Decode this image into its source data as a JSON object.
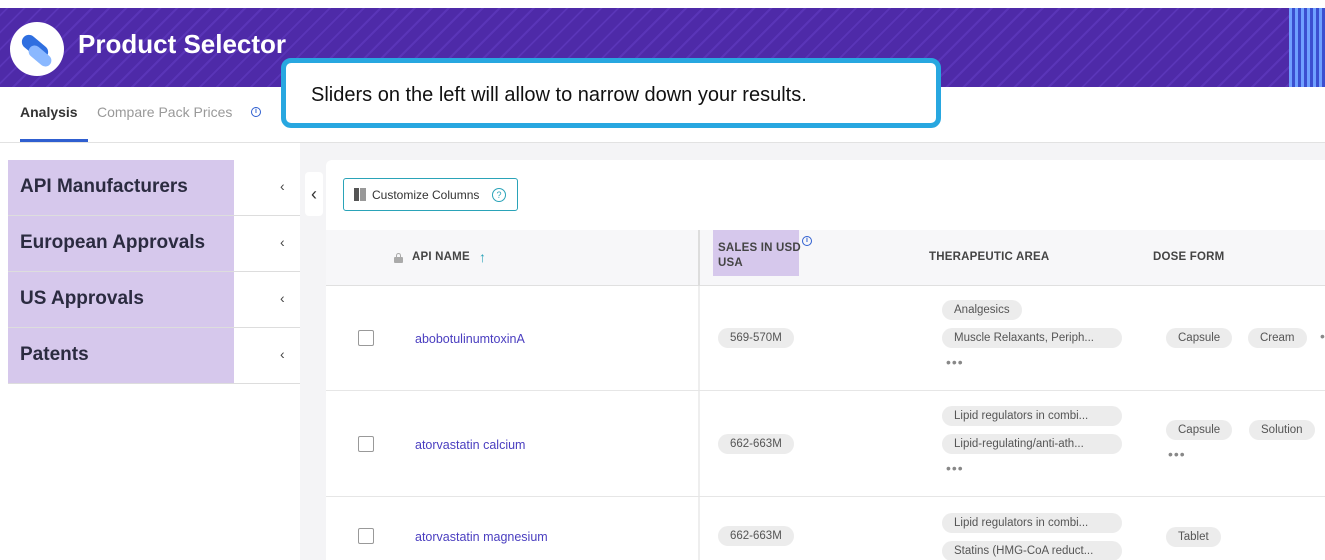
{
  "app": {
    "title": "Product Selector"
  },
  "tabs": [
    {
      "label": "Analysis",
      "active": true
    },
    {
      "label": "Compare Pack Prices",
      "active": false
    }
  ],
  "callout": {
    "text": "Sliders on the left will allow to narrow down your results."
  },
  "sidebar": {
    "items": [
      {
        "label": "API Manufacturers",
        "chevron": "‹"
      },
      {
        "label": "European Approvals",
        "chevron": "‹"
      },
      {
        "label": "US Approvals",
        "chevron": "‹"
      },
      {
        "label": "Patents",
        "chevron": "‹"
      }
    ],
    "collapse_glyph": "‹"
  },
  "toolbar": {
    "customize_label": "Customize Columns",
    "help_glyph": "?"
  },
  "grid": {
    "columns": {
      "api_name": "API NAME",
      "sales_line1": "SALES IN USD",
      "sales_line2": "USA",
      "therapeutic_area": "THERAPEUTIC AREA",
      "dose_form": "DOSE FORM"
    },
    "sort_glyph": "↑",
    "rows": [
      {
        "api_name": "abobotulinumtoxinA",
        "sales": "569-570M",
        "areas": [
          "Analgesics",
          "Muscle Relaxants, Periph..."
        ],
        "areas_more": "•••",
        "doses": [
          "Capsule",
          "Cream"
        ],
        "doses_more": "•"
      },
      {
        "api_name": "atorvastatin calcium",
        "sales": "662-663M",
        "areas": [
          "Lipid regulators in combi...",
          "Lipid-regulating/anti-ath..."
        ],
        "areas_more": "•••",
        "doses": [
          "Capsule",
          "Solution"
        ],
        "doses_more": "•••"
      },
      {
        "api_name": "atorvastatin magnesium",
        "sales": "662-663M",
        "areas": [
          "Lipid regulators in combi...",
          "Statins (HMG-CoA reduct..."
        ],
        "doses": [
          "Tablet"
        ]
      }
    ]
  },
  "colors": {
    "header_purple": "#4e2aa8",
    "highlight_lavender": "#d6c8ec",
    "callout_border": "#28a7e0",
    "link_purple": "#4a3ec0",
    "accent_teal": "#2aa3b8"
  }
}
